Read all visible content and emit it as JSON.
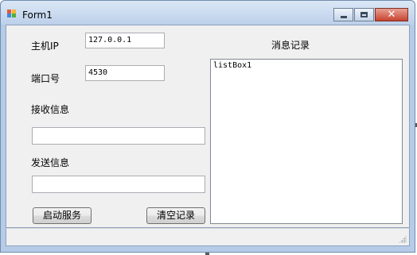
{
  "window": {
    "title": "Form1",
    "close_glyph": "✕"
  },
  "icons": {
    "app": "winforms-app-icon",
    "minimize": "minimize-icon",
    "maximize": "maximize-icon",
    "close": "close-icon"
  },
  "form": {
    "host_ip_label": "主机IP",
    "host_ip_value": "127.0.0.1",
    "port_label": "端口号",
    "port_value": "4530",
    "receive_label": "接收信息",
    "receive_value": "",
    "send_label": "发送信息",
    "send_value": "",
    "start_button": "启动服务",
    "clear_button": "清空记录",
    "log_title": "消息记录",
    "log_items": [
      "listBox1"
    ]
  },
  "colors": {
    "close_button": "#c7432f",
    "client_bg": "#f0f0f0"
  }
}
